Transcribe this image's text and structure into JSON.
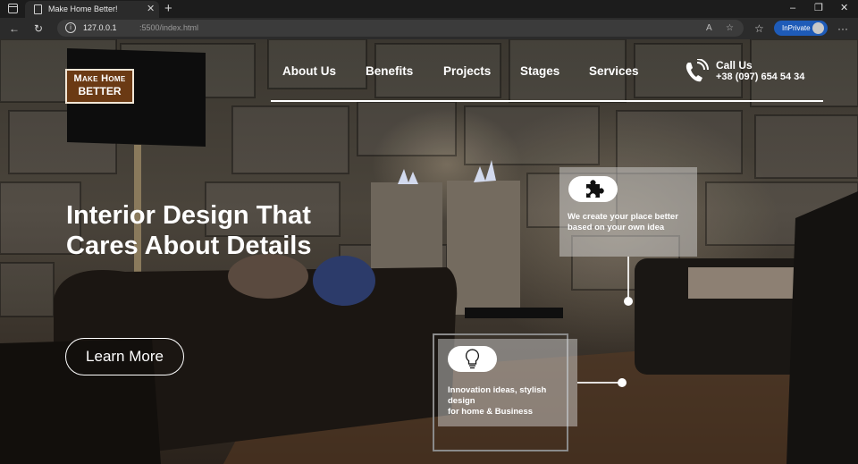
{
  "browser": {
    "tab_title": "Make Home Better!",
    "tab_close": "✕",
    "new_tab": "+",
    "controls": {
      "minimize": "–",
      "maximize": "❐",
      "close": "✕"
    },
    "url_host": "127.0.0.1",
    "url_path": ":5500/index.html",
    "inprivate_label": "InPrivate",
    "more": "···"
  },
  "logo": {
    "line1": "Make Home",
    "line2": "BETTER"
  },
  "nav": {
    "links": [
      "About Us",
      "Benefits",
      "Projects",
      "Stages",
      "Services"
    ],
    "call_label": "Call Us",
    "phone": "+38 (097) 654 54 34"
  },
  "hero": {
    "title": "Interior Design That Cares About Details",
    "cta": "Learn More"
  },
  "cards": [
    {
      "icon": "puzzle-icon",
      "text": "We create your place better based on your own idea"
    },
    {
      "icon": "lightbulb-icon",
      "line1": "Innovation ideas, stylish design",
      "line2": "for home & Business"
    }
  ],
  "colors": {
    "logo_bg": "#6b3a14",
    "inprivate": "#1e5bb8",
    "text": "#ffffff"
  }
}
